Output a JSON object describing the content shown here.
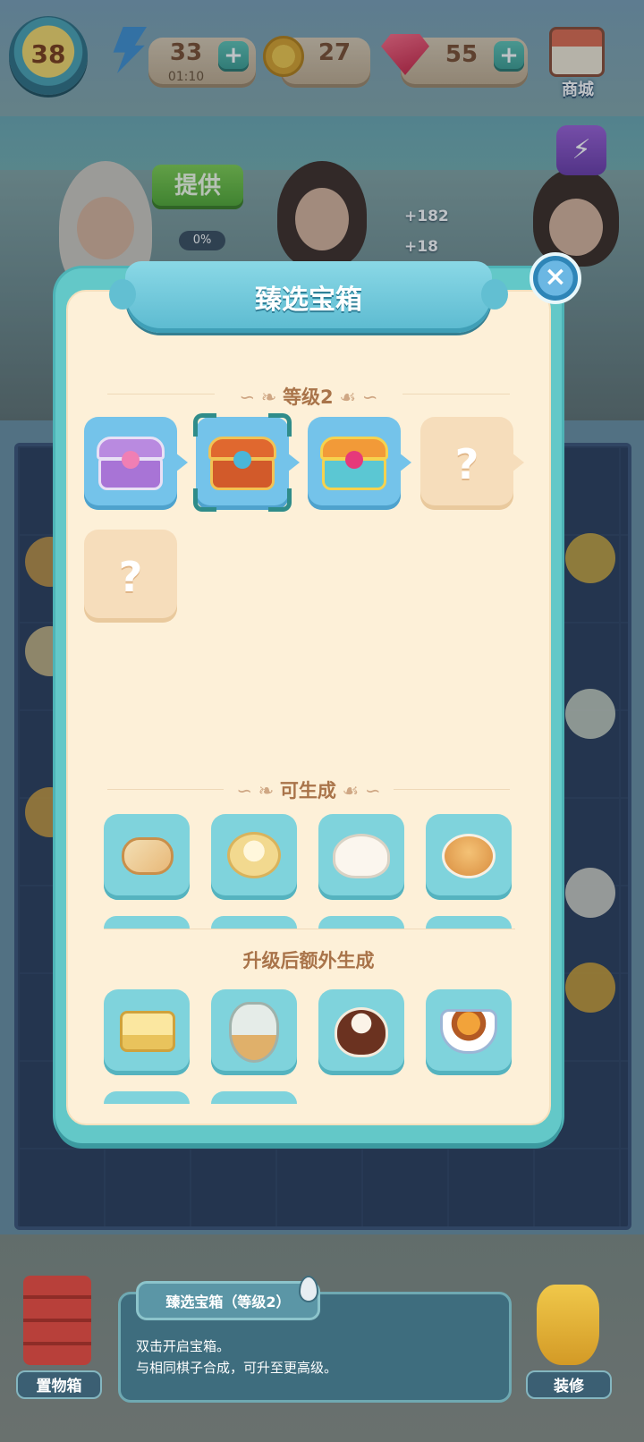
{
  "hud": {
    "level": "38",
    "energy_value": "33",
    "energy_timer": "01:10",
    "coins": "27",
    "gems": "55",
    "plus": "+",
    "shop_label": "商城"
  },
  "scene": {
    "provide_button": "提供",
    "progress_percent": "0%",
    "reward_1": "+182",
    "reward_2": "+18"
  },
  "modal": {
    "title": "臻选宝箱",
    "close": "×",
    "level_section": "等级2",
    "chest_tiles": [
      {
        "kind": "purple-chest",
        "state": "unlocked"
      },
      {
        "kind": "orange-chest",
        "state": "selected"
      },
      {
        "kind": "treasure-chest",
        "state": "unlocked"
      },
      {
        "kind": "unknown",
        "state": "locked",
        "label": "?"
      },
      {
        "kind": "unknown",
        "state": "locked",
        "label": "?"
      }
    ],
    "generate_section": "可生成",
    "generate_items": [
      "bread-roll-icon",
      "cream-bun-icon",
      "steamed-bun-icon",
      "sesame-bun-icon"
    ],
    "extra_section": "升级后额外生成",
    "extra_items": [
      "cake-slice-icon",
      "tea-set-icon",
      "chocolate-dessert-icon",
      "lemon-tea-icon"
    ]
  },
  "bottom": {
    "storage_label": "置物箱",
    "decorate_label": "装修",
    "info_title": "臻选宝箱（等级2）",
    "info_line_1": "双击开启宝箱。",
    "info_line_2": "与相同棋子合成，可升至更高级。"
  },
  "colors": {
    "modal_border": "#63c8c8",
    "modal_bg": "#fdf0d8",
    "section_text": "#a9744a",
    "tile_blue": "#74c3ea",
    "tile_locked": "#f6ddbb",
    "item_tile": "#7fd3dc"
  }
}
